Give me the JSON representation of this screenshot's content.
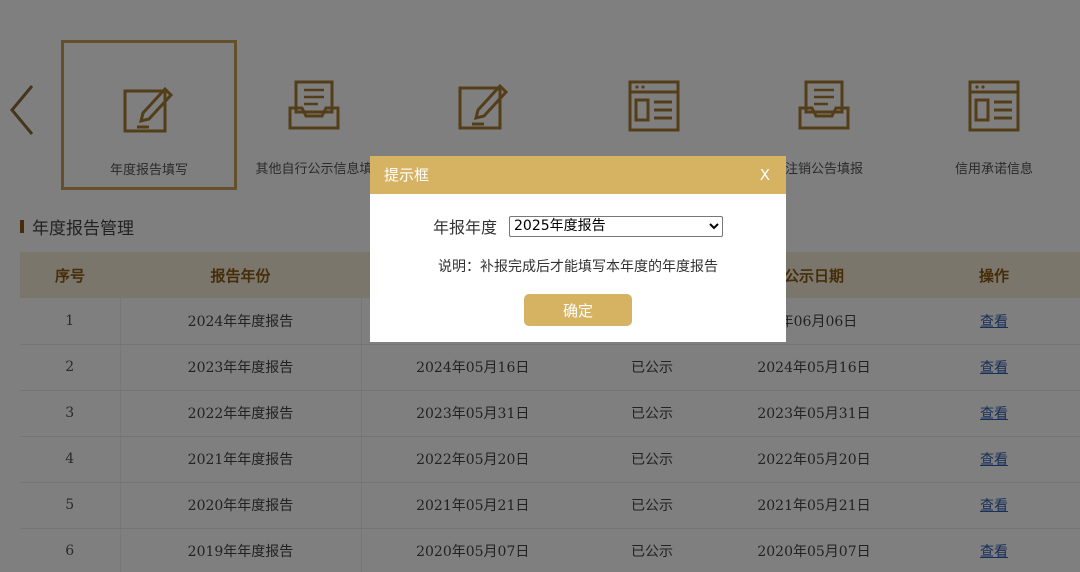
{
  "nav": {
    "items": [
      {
        "label": "年度报告填写",
        "icon": "edit-form-icon"
      },
      {
        "label": "其他自行公示信息填",
        "icon": "inbox-document-icon"
      },
      {
        "label": "",
        "icon": "edit-form-icon"
      },
      {
        "label": "",
        "icon": "web-page-icon"
      },
      {
        "label": "注销公告填报",
        "icon": "inbox-document-icon"
      },
      {
        "label": "信用承诺信息",
        "icon": "web-page-icon"
      }
    ]
  },
  "section": {
    "title": "年度报告管理"
  },
  "table": {
    "headers": [
      "序号",
      "报告年份",
      "",
      "",
      "公示日期",
      "操作"
    ],
    "rows": [
      {
        "no": "1",
        "year": "2024年年度报告",
        "submit": "",
        "status": "",
        "date": "5年06月06日",
        "action": "查看"
      },
      {
        "no": "2",
        "year": "2023年年度报告",
        "submit": "2024年05月16日",
        "status": "已公示",
        "date": "2024年05月16日",
        "action": "查看"
      },
      {
        "no": "3",
        "year": "2022年年度报告",
        "submit": "2023年05月31日",
        "status": "已公示",
        "date": "2023年05月31日",
        "action": "查看"
      },
      {
        "no": "4",
        "year": "2021年年度报告",
        "submit": "2022年05月20日",
        "status": "已公示",
        "date": "2022年05月20日",
        "action": "查看"
      },
      {
        "no": "5",
        "year": "2020年年度报告",
        "submit": "2021年05月21日",
        "status": "已公示",
        "date": "2021年05月21日",
        "action": "查看"
      },
      {
        "no": "6",
        "year": "2019年年度报告",
        "submit": "2020年05月07日",
        "status": "已公示",
        "date": "2020年05月07日",
        "action": "查看"
      }
    ]
  },
  "modal": {
    "title": "提示框",
    "close": "X",
    "year_label": "年报年度",
    "year_selected": "2025年度报告",
    "note": "说明：补报完成后才能填写本年度的年度报告",
    "ok": "确定"
  },
  "colors": {
    "accent": "#d6b263",
    "border": "#c9a256",
    "link": "#2f5fb3",
    "header_text": "#8a5a14"
  }
}
